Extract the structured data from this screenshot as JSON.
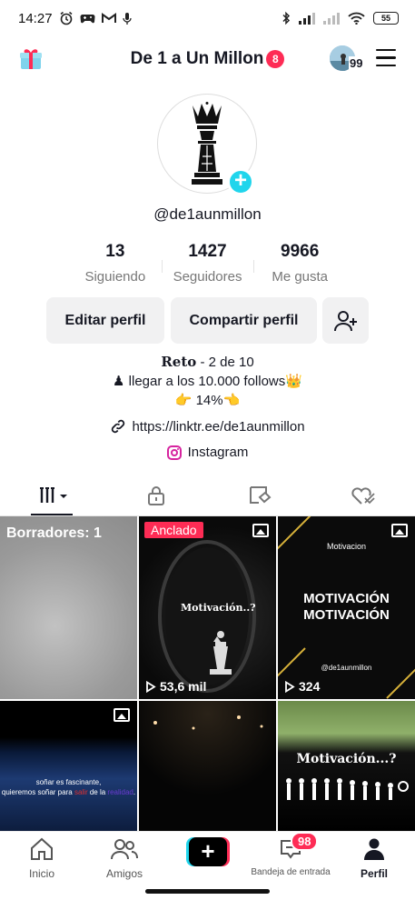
{
  "status_bar": {
    "time": "14:27",
    "battery": "55"
  },
  "header": {
    "title": "De 1 a Un Millon",
    "notification_count": "8",
    "avatar_count": "99"
  },
  "profile": {
    "username": "@de1aunmillon",
    "stats": [
      {
        "value": "13",
        "label": "Siguiendo"
      },
      {
        "value": "1427",
        "label": "Seguidores"
      },
      {
        "value": "9966",
        "label": "Me gusta"
      }
    ],
    "buttons": {
      "edit": "Editar perfil",
      "share": "Compartir perfil"
    },
    "bio": {
      "line1_bold": "Reto",
      "line1_rest": " - 2 de 10",
      "line2": "♟ llegar a los 10.000 follows👑",
      "line3": "👉 14%👈"
    },
    "link": "https://linktr.ee/de1aunmillon",
    "instagram": "Instagram"
  },
  "grid": {
    "tiles": [
      {
        "overlay": "Borradores: 1"
      },
      {
        "pinned_label": "Anclado",
        "caption": "Motivación..?",
        "views": "53,6 mil"
      },
      {
        "top_caption": "Motivacion",
        "headline1": "MOTIVACIÓN",
        "headline2": "MOTIVACIÓN",
        "handle": "@de1aunmillon",
        "views": "324"
      },
      {
        "caption_line1": "soñar es fascinante,",
        "caption_line2": "quieremos soñar para",
        "caption_highlight1": "salir",
        "caption_mid": " de la ",
        "caption_highlight2": "realidad",
        "caption_end": "."
      },
      {},
      {
        "caption": "Motivación...?"
      }
    ]
  },
  "nav": {
    "home": "Inicio",
    "friends": "Amigos",
    "inbox": "Bandeja de entrada",
    "inbox_count": "98",
    "profile": "Perfil"
  },
  "colors": {
    "accent": "#fe2c55",
    "cyan": "#20d5ec",
    "text": "#161823"
  }
}
